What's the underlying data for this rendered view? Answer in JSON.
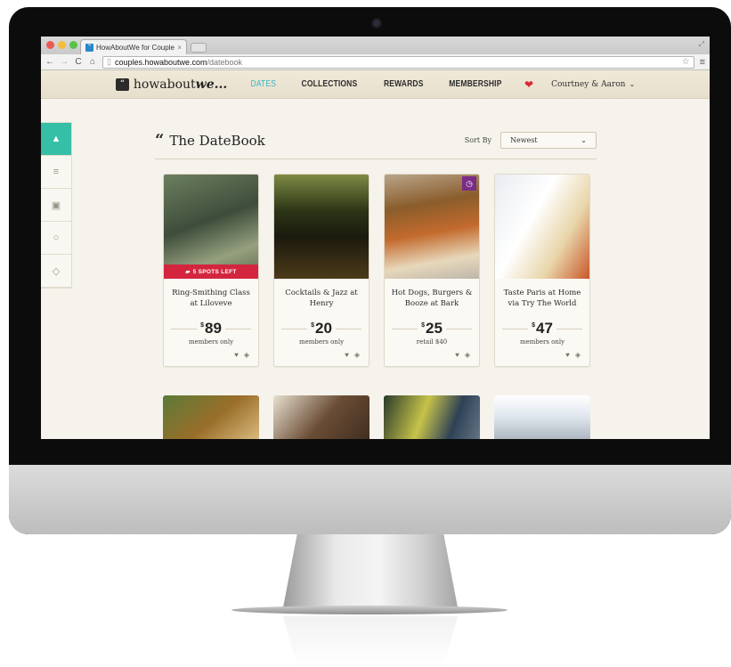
{
  "browser": {
    "tab_title": "HowAboutWe for Couples",
    "tab_close": "×",
    "url_domain": "couples.howaboutwe.com",
    "url_path": "/datebook"
  },
  "header": {
    "logo_text": "howabout",
    "logo_emph": "we...",
    "nav": [
      "DATES",
      "COLLECTIONS",
      "REWARDS",
      "MEMBERSHIP"
    ],
    "user": "Courtney & Aaron"
  },
  "page": {
    "title": "The DateBook",
    "sort_label": "Sort By",
    "sort_value": "Newest"
  },
  "cards": [
    {
      "title": "Ring-Smithing Class at Liloveve",
      "price": "89",
      "currency": "$",
      "sub": "members only",
      "badge": "5 SPOTS LEFT"
    },
    {
      "title": "Cocktails & Jazz at Henry",
      "price": "20",
      "currency": "$",
      "sub": "members only"
    },
    {
      "title": "Hot Dogs, Burgers & Booze at Bark",
      "price": "25",
      "currency": "$",
      "sub": "retail $40"
    },
    {
      "title": "Taste Paris at Home via Try The World",
      "price": "47",
      "currency": "$",
      "sub": "members only"
    }
  ],
  "icons": {
    "accent": "#35bfa6",
    "nav_active": "#3cb6c6",
    "badge_red": "#d3263e",
    "heart_red": "#d62a36"
  }
}
